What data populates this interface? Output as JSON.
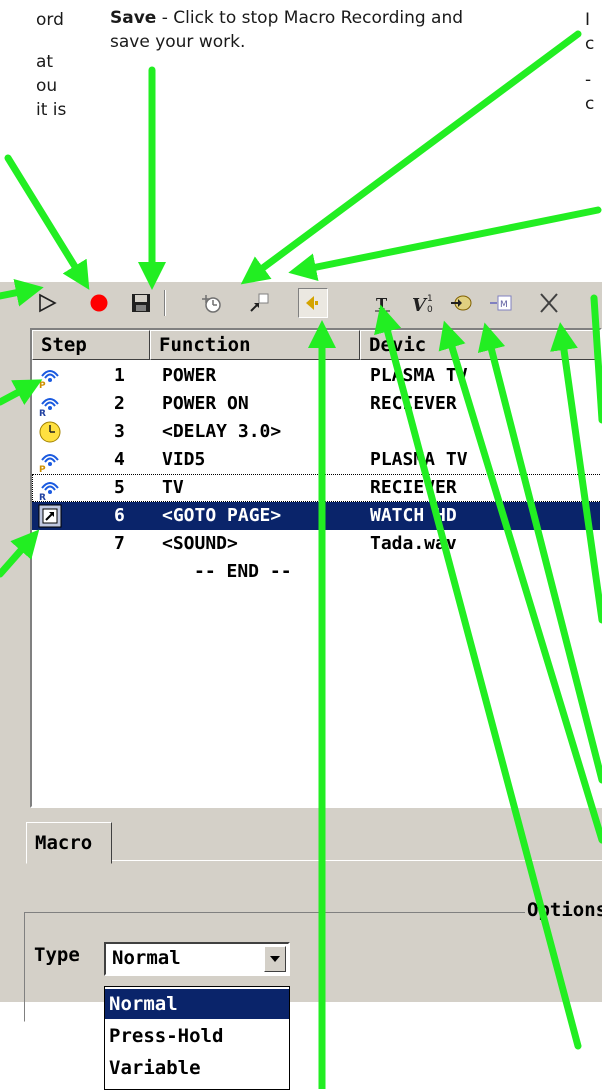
{
  "annotations": {
    "top_left_fragment": [
      "ord",
      "",
      "at",
      "ou",
      "it is"
    ],
    "save_bold": "Save",
    "save_text": " - Click to stop Macro Recording and save your work.",
    "top_right_fragment": [
      "I",
      "c",
      "-",
      "c"
    ]
  },
  "toolbar": {
    "buttons": [
      {
        "name": "play-icon"
      },
      {
        "name": "record-icon"
      },
      {
        "name": "save-icon"
      },
      {
        "name": "delay-icon"
      },
      {
        "name": "goto-page-icon"
      },
      {
        "name": "sound-icon"
      },
      {
        "name": "text-icon"
      },
      {
        "name": "variable-icon"
      },
      {
        "name": "device-icon"
      },
      {
        "name": "macro-icon"
      },
      {
        "name": "cut-icon"
      }
    ]
  },
  "list": {
    "columns": [
      "Step",
      "Function",
      "Devic"
    ],
    "rows": [
      {
        "step": "1",
        "function": "POWER",
        "device": "PLASMA TV",
        "icon": "ir-plasma-icon"
      },
      {
        "step": "2",
        "function": "POWER ON",
        "device": "RECIEVER",
        "icon": "ir-receiver-icon"
      },
      {
        "step": "3",
        "function": "<DELAY 3.0>",
        "device": "",
        "icon": "clock-icon"
      },
      {
        "step": "4",
        "function": "VID5",
        "device": "PLASMA TV",
        "icon": "ir-plasma-icon"
      },
      {
        "step": "5",
        "function": "TV",
        "device": "RECIEVER",
        "icon": "ir-receiver-icon"
      },
      {
        "step": "6",
        "function": "<GOTO PAGE>",
        "device": "WATCH HD",
        "icon": "goto-page-icon"
      },
      {
        "step": "7",
        "function": "<SOUND>",
        "device": "Tada.wav",
        "icon": ""
      }
    ],
    "end_label": "-- END --"
  },
  "tabs": {
    "macro": "Macro"
  },
  "options": {
    "title": "Options",
    "type_label": "Type",
    "type_value": "Normal",
    "type_options": [
      "Normal",
      "Press-Hold",
      "Variable"
    ]
  },
  "colors": {
    "arrow": "#22ee22",
    "selection": "#0a246a",
    "record": "#ff0000",
    "window": "#d4d0c8"
  }
}
